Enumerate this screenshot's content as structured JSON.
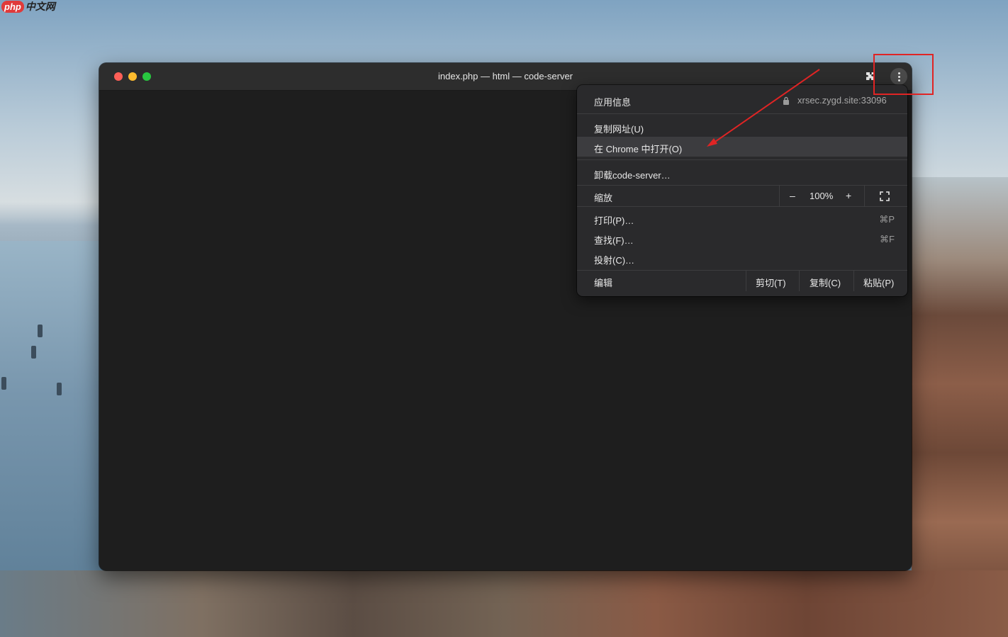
{
  "watermark": {
    "php": "php",
    "site": "中文网"
  },
  "window": {
    "title": "index.php — html — code-server",
    "extension_icon": "puzzle-icon",
    "menu_icon": "kebab-menu-icon"
  },
  "menu": {
    "app_info": {
      "label": "应用信息",
      "url": "xrsec.zygd.site:33096",
      "icon": "lock-icon"
    },
    "copy_url": "复制网址(U)",
    "open_in_chrome": "在 Chrome 中打开(O)",
    "uninstall": "卸载code-server…",
    "zoom": {
      "label": "缩放",
      "minus": "–",
      "value": "100%",
      "plus": "+",
      "fullscreen_icon": "fullscreen-icon"
    },
    "print": {
      "label": "打印(P)…",
      "shortcut": "⌘P"
    },
    "find": {
      "label": "查找(F)…",
      "shortcut": "⌘F"
    },
    "cast": "投射(C)…",
    "edit": {
      "label": "编辑",
      "cut": "剪切(T)",
      "copy": "复制(C)",
      "paste": "粘贴(P)"
    }
  },
  "colors": {
    "annotation": "#e02424",
    "menu_bg": "#2a2a2c",
    "editor_bg": "#1e1e1e"
  }
}
